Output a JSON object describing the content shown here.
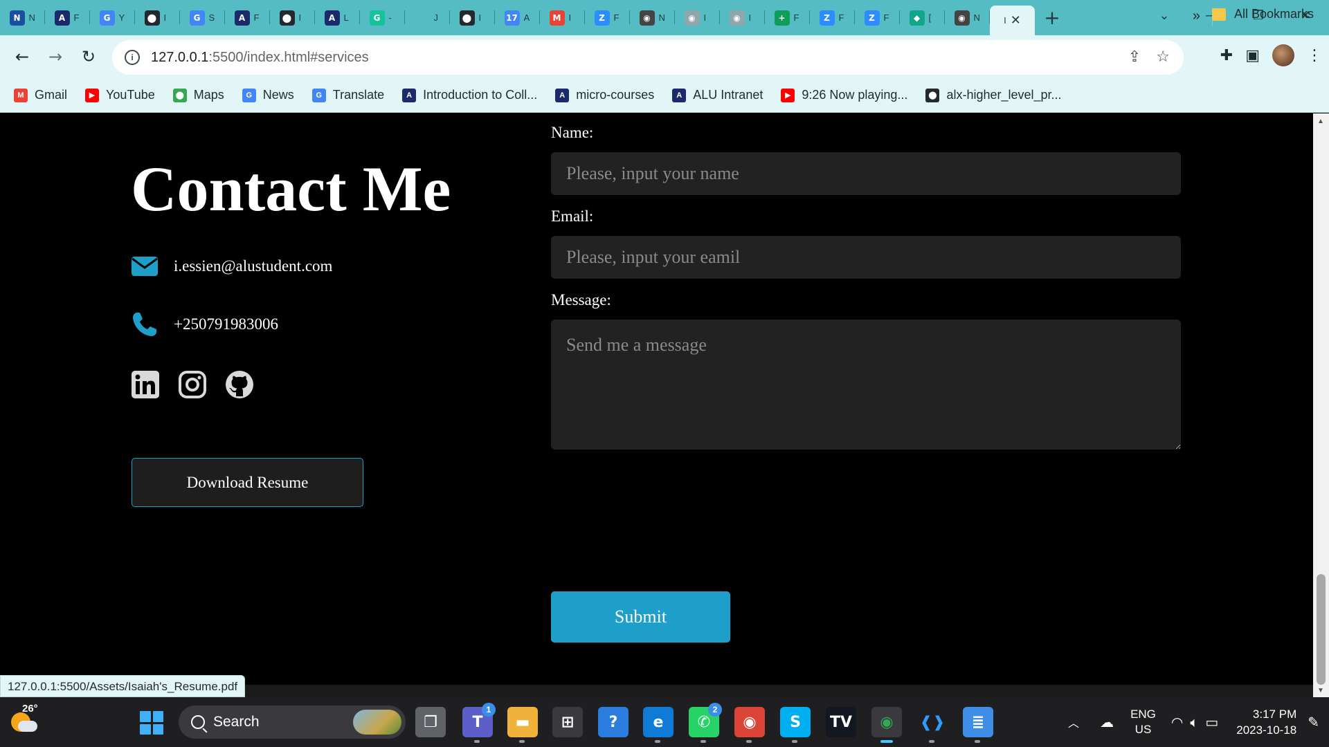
{
  "browser": {
    "tabs": [
      {
        "icon": "news-site-icon",
        "letter": "N",
        "color": "#1a4fa0",
        "label": "N"
      },
      {
        "icon": "alu-icon",
        "letter": "A",
        "color": "#1b2a6b",
        "label": "F"
      },
      {
        "icon": "google-icon",
        "letter": "G",
        "color": "#4285f4",
        "label": "Y"
      },
      {
        "icon": "github-icon",
        "letter": "⬤",
        "color": "#24292f",
        "label": "I"
      },
      {
        "icon": "google-icon",
        "letter": "G",
        "color": "#4285f4",
        "label": "S"
      },
      {
        "icon": "alu-icon",
        "letter": "A",
        "color": "#1b2a6b",
        "label": "F"
      },
      {
        "icon": "github-icon",
        "letter": "⬤",
        "color": "#24292f",
        "label": "I"
      },
      {
        "icon": "alu-icon",
        "letter": "A",
        "color": "#1b2a6b",
        "label": "L"
      },
      {
        "icon": "grammarly-icon",
        "letter": "G",
        "color": "#15c39a",
        "label": "-"
      },
      {
        "icon": "blank-icon",
        "letter": "",
        "color": "#56bcc4",
        "label": "J"
      },
      {
        "icon": "github-icon",
        "letter": "⬤",
        "color": "#24292f",
        "label": "I"
      },
      {
        "icon": "calendar-icon",
        "letter": "17",
        "color": "#4285f4",
        "label": "A"
      },
      {
        "icon": "gmail-icon",
        "letter": "M",
        "color": "#ea4335",
        "label": "I"
      },
      {
        "icon": "zoom-icon",
        "letter": "Z",
        "color": "#2d8cff",
        "label": "F"
      },
      {
        "icon": "chrome-icon",
        "letter": "◉",
        "color": "#444",
        "label": "N"
      },
      {
        "icon": "chrome-icon",
        "letter": "◉",
        "color": "#8fa7aa",
        "label": "I"
      },
      {
        "icon": "chrome-icon",
        "letter": "◉",
        "color": "#8fa7aa",
        "label": "I"
      },
      {
        "icon": "plus-doc-icon",
        "letter": "+",
        "color": "#0f9d58",
        "label": "F"
      },
      {
        "icon": "zoom-icon",
        "letter": "Z",
        "color": "#2d8cff",
        "label": "F"
      },
      {
        "icon": "zoom-icon",
        "letter": "Z",
        "color": "#2d8cff",
        "label": "F"
      },
      {
        "icon": "diamond-icon",
        "letter": "◆",
        "color": "#0fa68a",
        "label": "["
      },
      {
        "icon": "chrome-icon",
        "letter": "◉",
        "color": "#444",
        "label": "N"
      }
    ],
    "active_tab_label": "I",
    "address": {
      "host": "127.0.0.1",
      "path": ":5500/index.html#services"
    },
    "bookmarks": [
      {
        "label": "Gmail",
        "icon": "gmail-icon",
        "color": "#ea4335",
        "letter": "M"
      },
      {
        "label": "YouTube",
        "icon": "youtube-icon",
        "color": "#ff0000",
        "letter": "▶"
      },
      {
        "label": "Maps",
        "icon": "maps-icon",
        "color": "#34a853",
        "letter": "⬤"
      },
      {
        "label": "News",
        "icon": "news-icon",
        "color": "#4285f4",
        "letter": "G"
      },
      {
        "label": "Translate",
        "icon": "translate-icon",
        "color": "#4285f4",
        "letter": "G"
      },
      {
        "label": "Introduction to Coll...",
        "icon": "alu-icon",
        "color": "#1b2a6b",
        "letter": "A"
      },
      {
        "label": "micro-courses",
        "icon": "alu-icon",
        "color": "#1b2a6b",
        "letter": "A"
      },
      {
        "label": "ALU Intranet",
        "icon": "alu-icon",
        "color": "#1b2a6b",
        "letter": "A"
      },
      {
        "label": "9:26 Now playing...",
        "icon": "youtube-icon",
        "color": "#ff0000",
        "letter": "▶"
      },
      {
        "label": "alx-higher_level_pr...",
        "icon": "github-icon",
        "color": "#24292f",
        "letter": "⬤"
      }
    ],
    "bookmarks_more": "»",
    "all_bookmarks": "All Bookmarks",
    "status_url": "127.0.0.1:5500/Assets/Isaiah's_Resume.pdf"
  },
  "page": {
    "title": "Contact Me",
    "email": "i.essien@alustudent.com",
    "phone": "+250791983006",
    "resume_button": "Download Resume",
    "accent_color": "#1e9fc9",
    "form": {
      "name_label": "Name:",
      "name_placeholder": "Please, input your name",
      "email_label": "Email:",
      "email_placeholder": "Please, input your eamil",
      "message_label": "Message:",
      "message_placeholder": "Send me a message",
      "submit": "Submit"
    }
  },
  "taskbar": {
    "temperature": "26°",
    "search_label": "Search",
    "teams_badge": "1",
    "whatsapp_badge": "2",
    "lang_line1": "ENG",
    "lang_line2": "US",
    "time": "3:17 PM",
    "date": "2023-10-18"
  }
}
